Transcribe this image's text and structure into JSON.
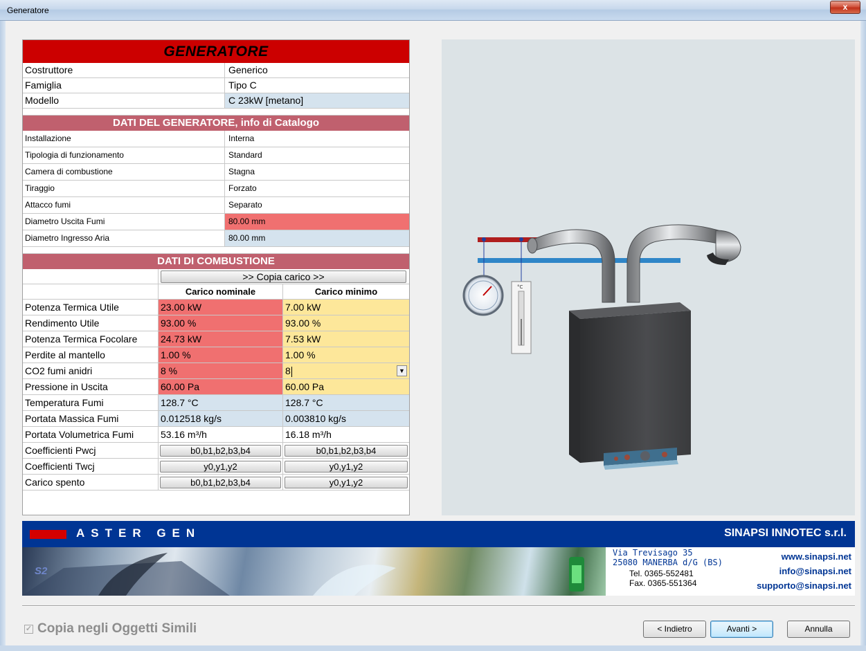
{
  "window": {
    "title": "Generatore",
    "close_label": "x"
  },
  "header": {
    "title": "GENERATORE"
  },
  "identity": [
    {
      "label": "Costruttore",
      "value": "Generico"
    },
    {
      "label": "Famiglia",
      "value": "Tipo C"
    },
    {
      "label": "Modello",
      "value": "C 23kW [metano]"
    }
  ],
  "catalog": {
    "title": "DATI DEL GENERATORE, info di Catalogo",
    "rows": [
      {
        "label": "Installazione",
        "value": "Interna"
      },
      {
        "label": "Tipologia di funzionamento",
        "value": "Standard"
      },
      {
        "label": "Camera di combustione",
        "value": "Stagna"
      },
      {
        "label": "Tiraggio",
        "value": "Forzato"
      },
      {
        "label": "Attacco fumi",
        "value": "Separato"
      },
      {
        "label": "Diametro Uscita Fumi",
        "value": "80.00 mm"
      },
      {
        "label": "Diametro Ingresso Aria",
        "value": "80.00 mm"
      }
    ]
  },
  "combustion": {
    "title": "DATI DI COMBUSTIONE",
    "copy_button": ">> Copia carico >>",
    "col_nominal": "Carico nominale",
    "col_minimum": "Carico minimo",
    "rows": [
      {
        "label": "Potenza Termica Utile",
        "nominal": "23.00 kW",
        "minimum": "7.00 kW"
      },
      {
        "label": "Rendimento Utile",
        "nominal": "93.00 %",
        "minimum": "93.00 %"
      },
      {
        "label": "Potenza Termica Focolare",
        "nominal": "24.73 kW",
        "minimum": "7.53 kW"
      },
      {
        "label": "Perdite al mantello",
        "nominal": "1.00 %",
        "minimum": "1.00 %"
      },
      {
        "label": "CO2 fumi anidri",
        "nominal": "8 %",
        "minimum": "8"
      },
      {
        "label": "Pressione in Uscita",
        "nominal": "60.00 Pa",
        "minimum": "60.00 Pa"
      },
      {
        "label": "Temperatura Fumi",
        "nominal": "128.7 °C",
        "minimum": "128.7 °C"
      },
      {
        "label": "Portata Massica Fumi",
        "nominal": "0.012518 kg/s",
        "minimum": "0.003810 kg/s"
      },
      {
        "label": "Portata Volumetrica Fumi",
        "nominal": "53.16 m³/h",
        "minimum": "16.18 m³/h"
      }
    ],
    "coeff_rows": [
      {
        "label": "Coefficienti Pwcj",
        "nominal": "b0,b1,b2,b3,b4",
        "minimum": "b0,b1,b2,b3,b4"
      },
      {
        "label": "Coefficienti Twcj",
        "nominal": "y0,y1,y2",
        "minimum": "y0,y1,y2"
      },
      {
        "label": "Carico spento",
        "nominal": "b0,b1,b2,b3,b4",
        "minimum": "y0,y1,y2"
      }
    ]
  },
  "banner": {
    "brand": "ASTER GEN",
    "company": "SINAPSI INNOTEC s.r.l.",
    "address_line1": "Via Trevisago 35",
    "address_line2": "25080 MANERBA d/G (BS)",
    "tel": "Tel. 0365-552481",
    "fax": "Fax. 0365-551364",
    "web": "www.sinapsi.net",
    "email_info": "info@sinapsi.net",
    "email_support": "supporto@sinapsi.net",
    "logo_text": "S2"
  },
  "footer": {
    "copy_similar": "Copia negli Oggetti Simili",
    "back": "< Indietro",
    "next": "Avanti >",
    "cancel": "Annulla"
  },
  "illustration": {
    "thermometer_unit": "°C"
  }
}
